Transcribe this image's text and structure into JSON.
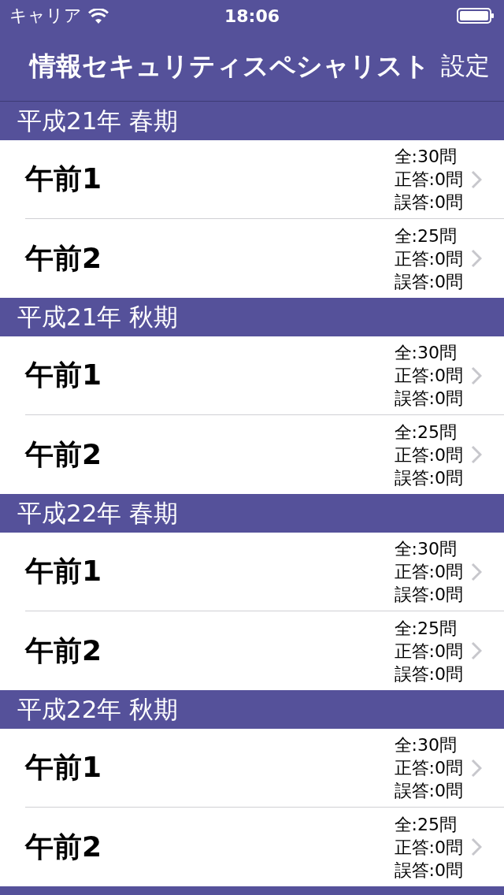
{
  "status_bar": {
    "carrier": "キャリア",
    "time": "18:06"
  },
  "nav_bar": {
    "title": "情報セキュリティスペシャリスト",
    "action": "設定"
  },
  "sections": [
    {
      "title": "平成21年 春期",
      "rows": [
        {
          "title": "午前1",
          "stats": [
            "全:30問",
            "正答:0問",
            "誤答:0問"
          ]
        },
        {
          "title": "午前2",
          "stats": [
            "全:25問",
            "正答:0問",
            "誤答:0問"
          ]
        }
      ]
    },
    {
      "title": "平成21年 秋期",
      "rows": [
        {
          "title": "午前1",
          "stats": [
            "全:30問",
            "正答:0問",
            "誤答:0問"
          ]
        },
        {
          "title": "午前2",
          "stats": [
            "全:25問",
            "正答:0問",
            "誤答:0問"
          ]
        }
      ]
    },
    {
      "title": "平成22年 春期",
      "rows": [
        {
          "title": "午前1",
          "stats": [
            "全:30問",
            "正答:0問",
            "誤答:0問"
          ]
        },
        {
          "title": "午前2",
          "stats": [
            "全:25問",
            "正答:0問",
            "誤答:0問"
          ]
        }
      ]
    },
    {
      "title": "平成22年 秋期",
      "rows": [
        {
          "title": "午前1",
          "stats": [
            "全:30問",
            "正答:0問",
            "誤答:0問"
          ]
        },
        {
          "title": "午前2",
          "stats": [
            "全:25問",
            "正答:0問",
            "誤答:0問"
          ]
        }
      ]
    }
  ]
}
